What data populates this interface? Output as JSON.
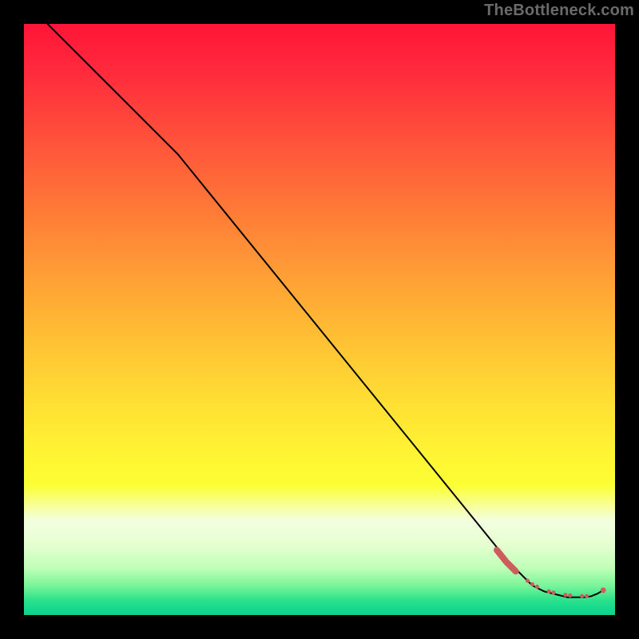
{
  "watermark": "TheBottleneck.com",
  "chart_data": {
    "type": "line",
    "title": "",
    "xlabel": "",
    "ylabel": "",
    "xlim": [
      0,
      100
    ],
    "ylim": [
      0,
      100
    ],
    "grid": false,
    "series": [
      {
        "name": "bottleneck-curve",
        "color": "#000000",
        "width": 2,
        "x": [
          4,
          26,
          82,
          86,
          88,
          90,
          92,
          94,
          95,
          96,
          97,
          98
        ],
        "y": [
          100,
          78,
          9,
          5,
          4,
          3.5,
          3,
          3,
          3,
          3.2,
          3.6,
          4.2
        ]
      }
    ],
    "markers": [
      {
        "name": "gpu-range-dots",
        "color": "#cd5c5c",
        "style": "dashed-dots",
        "x": [
          80.0,
          80.8,
          81.6,
          82.4,
          83.2,
          85.2,
          86.0,
          86.8,
          88.8,
          89.6,
          91.6,
          92.4,
          94.4,
          95.2,
          98.0
        ],
        "y": [
          11.0,
          10.0,
          9.0,
          8.2,
          7.4,
          5.8,
          5.2,
          4.8,
          4.0,
          3.8,
          3.4,
          3.3,
          3.2,
          3.2,
          4.2
        ],
        "r": [
          2.6,
          2.6,
          2.6,
          2.6,
          2.6,
          2.6,
          2.6,
          2.6,
          2.6,
          2.6,
          2.6,
          2.6,
          2.6,
          2.6,
          3.4
        ]
      }
    ],
    "gradient_stops": [
      {
        "pos": 0,
        "color": "#ff1537"
      },
      {
        "pos": 50,
        "color": "#ffd633"
      },
      {
        "pos": 78,
        "color": "#fcff33"
      },
      {
        "pos": 95,
        "color": "#7af59a"
      },
      {
        "pos": 100,
        "color": "#0fd18f"
      }
    ]
  }
}
